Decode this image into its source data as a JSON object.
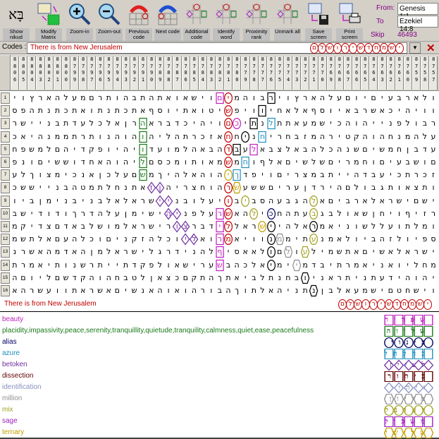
{
  "toolbar": {
    "buttons": [
      {
        "label": "Show nikud",
        "icon": "nikud-icon"
      },
      {
        "label": "Modify Matrix",
        "icon": "matrix-icon"
      },
      {
        "label": "Zoom-in",
        "icon": "zoom-in-icon"
      },
      {
        "label": "Zoom-out",
        "icon": "zoom-out-icon"
      },
      {
        "label": "Previous code",
        "icon": "previous-code-icon"
      },
      {
        "label": "Next code",
        "icon": "next-code-icon"
      },
      {
        "label": "Additional code",
        "icon": "additional-code-icon"
      },
      {
        "label": "Identify word",
        "icon": "identify-word-icon"
      },
      {
        "label": "Proximity rank",
        "icon": "proximity-icon"
      },
      {
        "label": "Unmark all",
        "icon": "unmark-icon"
      },
      {
        "label": "Save screen",
        "icon": "save-icon"
      },
      {
        "label": "Print screen",
        "icon": "print-icon"
      }
    ],
    "nikud_glyph": "בָּא",
    "from_label": "From:",
    "from_value": "Genesis 1:1",
    "to_label": "To",
    "to_value": "Ezekiel 14:8",
    "skip_label": "Skip",
    "skip_value": "46493"
  },
  "codes_bar": {
    "label": "Codes :",
    "value": "There is from New Jerusalem",
    "code_letters": "ישמחדשירושלם",
    "close_glyph": "✕",
    "dropdown_glyph": "▼"
  },
  "column_numbers": [
    8806,
    8805,
    8804,
    8803,
    8802,
    8801,
    8800,
    8799,
    8798,
    8797,
    8796,
    8795,
    8794,
    8793,
    8792,
    8791,
    8790,
    8789,
    8788,
    8787,
    8786,
    8785,
    8784,
    8783,
    8782,
    8781,
    8780,
    8779,
    8778,
    8777,
    8776,
    8775,
    8774,
    8773,
    8772,
    8771,
    8770,
    8769,
    8768,
    8767,
    8766,
    8765,
    8764,
    8763,
    8762,
    8761,
    8760,
    8759,
    8758,
    8757
  ],
  "rows": [
    "ולארבעיםיוםעלהארץוירבוהמיםוישאואתהתבהותרםמעלהארץוי",
    "וויהיכאשרבאיוסףאלאחיוויפשיטואתיוסףאתכתנתואתכתנתהפס",
    "רבולפנייהוהכישמעאתתלנתיכםויהיכדבראהרןאלכלעדתבניישר",
    "עלהמנחהוהקטירהמזבחריחניחחאזכרתהליהוהוהנותרתממנהיאכ",
    "עדבןחמשיםשנהכלהבאלצבאלעבדהבאהלמועדויהיופקדיהםלמשפח",
    "םושבעיםוחמריםשלשיםאלףוחמשמאותומכסםליהוהאחדוששיםונפ",
    "זכרתכיעבדהייתבמצריםויפדךיהוהאלהיךמשםעלכןאנכימצוךלע",
    "ותצאותגבולםהירדןעריםששעשרהוחצריהןזאתנחלתמטהבנייששכ",
    "ישםישראלארביםאלהגבעהסביבויעלובניישראלאלבניבנימןביו",
    "רזיףויחןשאולבגבעתהחכילהאשרעלפניהישימןעלהדרךודודישב",
    "ומלתועללשוניאמראלהיישראללידברצורישראלמושלבאדםצדיקמ",
    "ספיולזהביולאמנעתיממנוויאמרואליוכלהזקניםוכלהעםאלתשמ",
    "ישראלאשיםאתשמילעולםולאאסיףלהנידרגלישראלמןהאדמהאשרנ",
    "מחליואניאמרתיבדמיימיאלכהבשערישאולפקדתייתרשנותיאמרת",
    "יהוהידעתניתראניובחנתלביאתךהתקםכצאןלטבחהוהקדשםליוםה",
    "וישחטםישמעאלבןנתניהאלתוךהבורהואוהאנשיםאשראתוועשרהא"
  ],
  "marks": [
    {
      "row": 1,
      "col": 20,
      "shape": "box",
      "color": "#000000"
    },
    {
      "row": 1,
      "col": 25,
      "shape": "circle",
      "color": "#c00000"
    },
    {
      "row": 1,
      "col": 26,
      "shape": "box",
      "color": "#c020c0"
    },
    {
      "row": 2,
      "col": 21,
      "shape": "box",
      "color": "#000000"
    },
    {
      "row": 2,
      "col": 25,
      "shape": "circle",
      "color": "#c00000"
    },
    {
      "row": 3,
      "col": 20,
      "shape": "box",
      "color": "#2090c0"
    },
    {
      "row": 3,
      "col": 22,
      "shape": "box",
      "color": "#000000"
    },
    {
      "row": 3,
      "col": 24,
      "shape": "circle",
      "color": "#c020c0"
    },
    {
      "row": 3,
      "col": 25,
      "shape": "circle",
      "color": "#c00000"
    },
    {
      "row": 3,
      "col": 35,
      "shape": "box",
      "color": "#1a7a1a"
    },
    {
      "row": 4,
      "col": 21,
      "shape": "box",
      "color": "#2090c0"
    },
    {
      "row": 4,
      "col": 23,
      "shape": "circle",
      "color": "#000000"
    },
    {
      "row": 4,
      "col": 25,
      "shape": "circle",
      "color": "#c00000"
    },
    {
      "row": 4,
      "col": 35,
      "shape": "box",
      "color": "#1a7a1a"
    },
    {
      "row": 5,
      "col": 22,
      "shape": "box",
      "color": "#c020c0"
    },
    {
      "row": 5,
      "col": 24,
      "shape": "box",
      "color": "#000000"
    },
    {
      "row": 5,
      "col": 25,
      "shape": "circle",
      "color": "#c00000"
    },
    {
      "row": 5,
      "col": 35,
      "shape": "box",
      "color": "#1a7a1a"
    },
    {
      "row": 6,
      "col": 23,
      "shape": "box",
      "color": "#2090c0"
    },
    {
      "row": 6,
      "col": 25,
      "shape": "circle",
      "color": "#c00000"
    },
    {
      "row": 6,
      "col": 35,
      "shape": "box",
      "color": "#1a7a1a"
    },
    {
      "row": 7,
      "col": 24,
      "shape": "box",
      "color": "#2090c0"
    },
    {
      "row": 7,
      "col": 25,
      "shape": "circle",
      "color": "#c0a000"
    },
    {
      "row": 7,
      "col": 35,
      "shape": "box",
      "color": "#1a7a1a"
    },
    {
      "row": 8,
      "col": 24,
      "shape": "hex",
      "color": "#c0a000"
    },
    {
      "row": 8,
      "col": 25,
      "shape": "circle",
      "color": "#c00000"
    },
    {
      "row": 8,
      "col": 33,
      "shape": "diamond",
      "color": "#7030a0"
    },
    {
      "row": 8,
      "col": 34,
      "shape": "diamond",
      "color": "#7030a0"
    },
    {
      "row": 9,
      "col": 15,
      "shape": "circle",
      "color": "#a0a020"
    },
    {
      "row": 9,
      "col": 23,
      "shape": "circle",
      "color": "#a0a020"
    },
    {
      "row": 9,
      "col": 25,
      "shape": "circle",
      "color": "#c00000"
    },
    {
      "row": 9,
      "col": 32,
      "shape": "diamond",
      "color": "#7030a0"
    },
    {
      "row": 9,
      "col": 33,
      "shape": "diamond",
      "color": "#7030a0"
    },
    {
      "row": 10,
      "col": 15,
      "shape": "circle",
      "color": "#a0a020"
    },
    {
      "row": 10,
      "col": 20,
      "shape": "circle",
      "color": "#000060"
    },
    {
      "row": 10,
      "col": 22,
      "shape": "circle",
      "color": "#a0a020"
    },
    {
      "row": 10,
      "col": 25,
      "shape": "circle",
      "color": "#c00000"
    },
    {
      "row": 10,
      "col": 26,
      "shape": "box",
      "color": "#c020c0"
    },
    {
      "row": 10,
      "col": 31,
      "shape": "diamond",
      "color": "#7030a0"
    },
    {
      "row": 10,
      "col": 32,
      "shape": "diamond",
      "color": "#7030a0"
    },
    {
      "row": 11,
      "col": 15,
      "shape": "circle",
      "color": "#000000"
    },
    {
      "row": 11,
      "col": 20,
      "shape": "circle",
      "color": "#000000"
    },
    {
      "row": 11,
      "col": 21,
      "shape": "circle",
      "color": "#c0a000"
    },
    {
      "row": 11,
      "col": 25,
      "shape": "circle",
      "color": "#c00000"
    },
    {
      "row": 11,
      "col": 26,
      "shape": "box",
      "color": "#c020c0"
    },
    {
      "row": 11,
      "col": 30,
      "shape": "diamond",
      "color": "#7030a0"
    },
    {
      "row": 11,
      "col": 31,
      "shape": "diamond",
      "color": "#7030a0"
    },
    {
      "row": 12,
      "col": 15,
      "shape": "circle",
      "color": "#a0a020"
    },
    {
      "row": 12,
      "col": 19,
      "shape": "hex",
      "color": "#909090"
    },
    {
      "row": 12,
      "col": 20,
      "shape": "circle",
      "color": "#000000"
    },
    {
      "row": 12,
      "col": 25,
      "shape": "circle",
      "color": "#c00000"
    },
    {
      "row": 12,
      "col": 26,
      "shape": "box",
      "color": "#c020c0"
    },
    {
      "row": 12,
      "col": 29,
      "shape": "diamond",
      "color": "#7030a0"
    },
    {
      "row": 12,
      "col": 30,
      "shape": "diamond",
      "color": "#7030a0"
    },
    {
      "row": 13,
      "col": 16,
      "shape": "hex",
      "color": "#a0a020"
    },
    {
      "row": 13,
      "col": 18,
      "shape": "hex",
      "color": "#909090"
    },
    {
      "row": 13,
      "col": 20,
      "shape": "circle",
      "color": "#000000"
    },
    {
      "row": 13,
      "col": 26,
      "shape": "box",
      "color": "#c020c0"
    },
    {
      "row": 14,
      "col": 17,
      "shape": "hex",
      "color": "#909090"
    },
    {
      "row": 14,
      "col": 20,
      "shape": "circle",
      "color": "#000000"
    },
    {
      "row": 14,
      "col": 26,
      "shape": "box",
      "color": "#c020c0"
    },
    {
      "row": 15,
      "col": 16,
      "shape": "hex",
      "color": "#000000"
    },
    {
      "row": 16,
      "col": 15,
      "shape": "hex",
      "color": "#000000"
    }
  ],
  "code_line": {
    "text": "There is from New Jerusalem",
    "letters": "ישמחדשירושלם",
    "color": "#c00000"
  },
  "words": [
    {
      "text": "beauty",
      "color": "#c020c0",
      "hebrew": "שפריר",
      "shape": "box"
    },
    {
      "text": "placidity,impassivity,peace,serenity,tranquillity,quietude,tranquility,calmness,quiet,ease,peacefulness",
      "color": "#1a7a1a",
      "hebrew": "שלווה",
      "shape": "box"
    },
    {
      "text": "alias",
      "color": "#000060",
      "hebrew": "כינוי",
      "shape": "circle"
    },
    {
      "text": "azure",
      "color": "#2090c0",
      "hebrew": "כחלחל",
      "shape": "box"
    },
    {
      "text": "betoken",
      "color": "#7030a0",
      "hebrew": "לציין",
      "shape": "diamond"
    },
    {
      "text": "dissection",
      "color": "#600000",
      "hebrew": "ביתור",
      "shape": "box"
    },
    {
      "text": "identification",
      "color": "#8890c0",
      "hebrew": "זיהוי",
      "shape": "diamond"
    },
    {
      "text": "million",
      "color": "#909090",
      "hebrew": "מליון",
      "shape": "hex"
    },
    {
      "text": "mix",
      "color": "#a0a020",
      "hebrew": "לערבל",
      "shape": "circle"
    },
    {
      "text": "sage",
      "color": "#a020c0",
      "hebrew": "משכיל",
      "shape": "box"
    },
    {
      "text": "ternary",
      "color": "#c0a000",
      "hebrew": "שלישי",
      "shape": "hex"
    }
  ]
}
